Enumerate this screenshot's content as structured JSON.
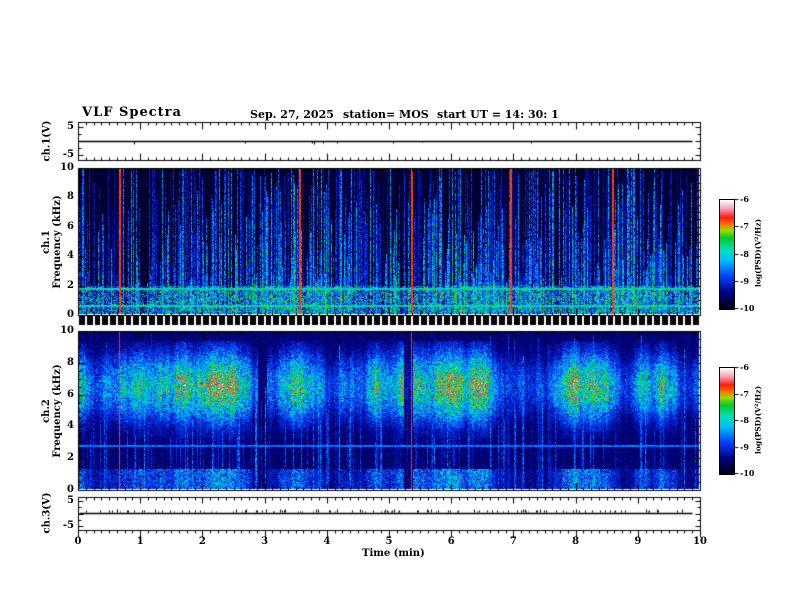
{
  "header": {
    "title": "VLF Spectra",
    "date": "Sep. 27, 2025",
    "station": "station= MOS",
    "start_ut": "start UT =  14: 30: 1"
  },
  "x_axis": {
    "label": "Time (min)",
    "ticks": [
      "0",
      "1",
      "2",
      "3",
      "4",
      "5",
      "6",
      "7",
      "8",
      "9",
      "10"
    ]
  },
  "panels": {
    "ch1v": {
      "label": "ch.1(V)",
      "ticks": [
        "5",
        "-5"
      ]
    },
    "spec1": {
      "label_line1": "ch.1",
      "label_line2": "Frequency (kHz)",
      "ticks": [
        "10",
        "8",
        "6",
        "4",
        "2",
        "0"
      ]
    },
    "spec2": {
      "label_line1": "ch.2",
      "label_line2": "Frequency (kHz)",
      "ticks": [
        "10",
        "8",
        "6",
        "4",
        "2",
        "0"
      ]
    },
    "ch3v": {
      "label": "ch.3(V)",
      "ticks": [
        "5",
        "-5"
      ]
    }
  },
  "colorbar": {
    "label": "log(PSD)(V²/Hz)",
    "ticks": [
      "-6",
      "-7",
      "-8",
      "-9",
      "-10"
    ]
  },
  "chart_data": {
    "type": "heatmap",
    "title": "VLF Spectra",
    "date": "Sep. 27, 2025",
    "station": "MOS",
    "start_ut": "14: 30: 1",
    "x": {
      "label": "Time (min)",
      "range": [
        0,
        10
      ],
      "major_tick": 1,
      "minor_per_major": 8
    },
    "colorbar": {
      "label": "log(PSD)(V²/Hz)",
      "range_low_to_high": [
        -10,
        -6
      ],
      "ticks": [
        -6,
        -7,
        -8,
        -9,
        -10
      ]
    },
    "palette_low_to_high": [
      {
        "v": 0.0,
        "color": "#000010"
      },
      {
        "v": 0.15,
        "color": "#000080"
      },
      {
        "v": 0.3,
        "color": "#0040ff"
      },
      {
        "v": 0.45,
        "color": "#00c0ff"
      },
      {
        "v": 0.55,
        "color": "#00e0b0"
      },
      {
        "v": 0.65,
        "color": "#00c830"
      },
      {
        "v": 0.72,
        "color": "#90e000"
      },
      {
        "v": 0.78,
        "color": "#ff7000"
      },
      {
        "v": 0.84,
        "color": "#ff1810"
      },
      {
        "v": 0.92,
        "color": "#ffa0b4"
      },
      {
        "v": 1.0,
        "color": "#ffffff"
      }
    ],
    "panels": [
      {
        "name": "ch.1(V)",
        "type": "waveform",
        "y_range": [
          -5,
          5
        ],
        "description": "flat trace at ~0 V spanning 0 to ~9.9 min with rare tiny downward blips"
      },
      {
        "name": "ch.1",
        "type": "spectrogram",
        "y_label": "Frequency (kHz)",
        "y_range": [
          0,
          10
        ],
        "background_level": -10,
        "horizontal_lines_khz": [
          0.55,
          1.7
        ],
        "red_streaks_min": [
          0.65,
          3.55,
          5.35,
          6.95,
          8.6
        ],
        "description": "dense impulsive broadband vertical streaks (blue/cyan/green), strongest below 2 kHz, many reaching 10 kHz"
      },
      {
        "name": "ch.2",
        "type": "spectrogram",
        "y_label": "Frequency (kHz)",
        "y_range": [
          0,
          10
        ],
        "background_level": -10,
        "band_khz": {
          "center": 6.5,
          "sigma": 1.7,
          "peak_level": -6.8
        },
        "weak_band_below_khz": 1.3,
        "red_streaks_min": [
          0.65,
          5.35
        ],
        "dim_columns_min": [
          2.95,
          5.3
        ],
        "description": "continuous intense mottled band ~4.5-9 kHz (green/yellow/red) with vertical striations over blue noise"
      },
      {
        "name": "ch.3(V)",
        "type": "waveform",
        "y_range": [
          -5,
          5
        ],
        "description": "flat trace at ~0 V with frequent small upward noise spikes"
      }
    ]
  }
}
